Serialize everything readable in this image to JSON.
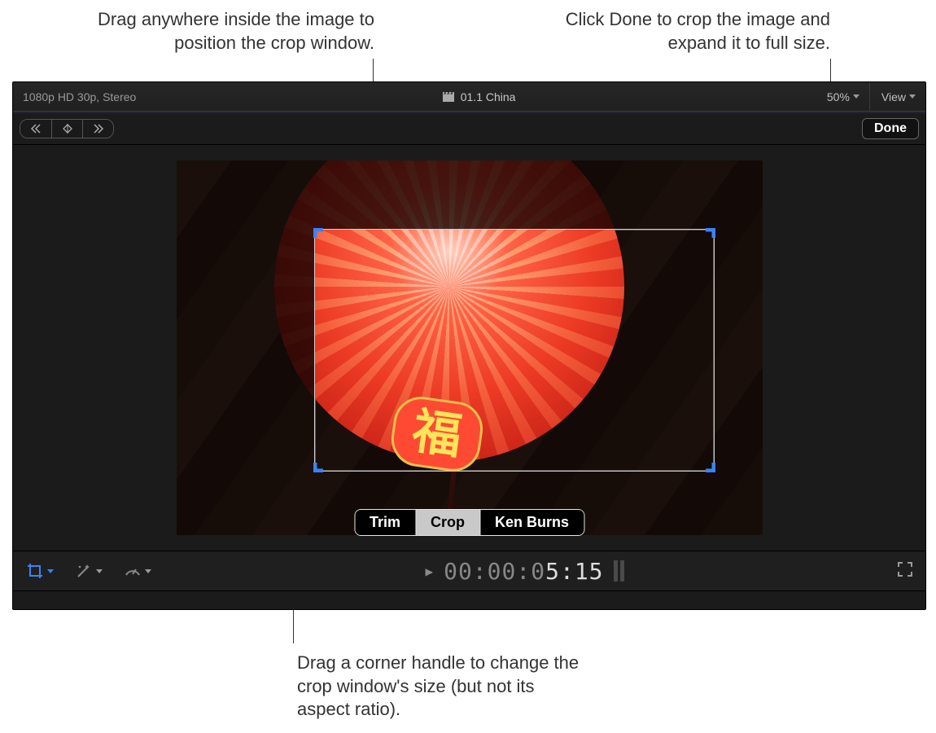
{
  "callouts": {
    "top_left": "Drag anywhere inside the image to position the crop window.",
    "top_right": "Click Done to crop the image and expand it to full size.",
    "bottom": "Drag a corner handle to change the crop window's size (but not its aspect ratio)."
  },
  "header": {
    "format": "1080p HD 30p, Stereo",
    "clip_name": "01.1 China",
    "zoom": "50%",
    "view_label": "View"
  },
  "toolbar": {
    "done_label": "Done"
  },
  "crop_modes": {
    "trim": "Trim",
    "crop": "Crop",
    "ken": "Ken Burns"
  },
  "medallion_char": "福",
  "footer": {
    "timecode_dim": "00:00:0",
    "timecode_bright": "5:15",
    "play_glyph": "▶",
    "timecode_prefix": "▶"
  }
}
